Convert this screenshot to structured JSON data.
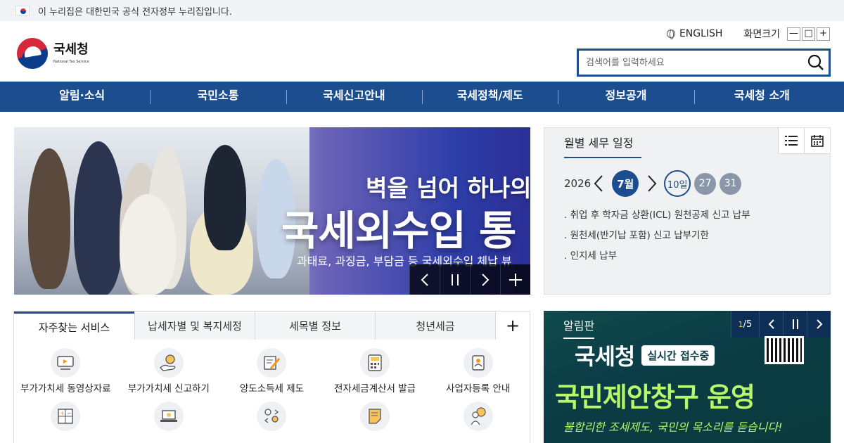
{
  "gov_bar": {
    "text": "이 누리집은 대한민국 공식 전자정부 누리집입니다."
  },
  "logo": {
    "name_ko": "국세청",
    "name_en": "National Tax Service"
  },
  "util": {
    "lang": "ENGLISH",
    "zoom_label": "화면크기",
    "zoom_out": "—",
    "zoom_reset": "□",
    "zoom_in": "+"
  },
  "search": {
    "placeholder": "검색어를 입력하세요"
  },
  "nav": {
    "items": [
      "알림·소식",
      "국민소통",
      "국세신고안내",
      "국세정책/제도",
      "정보공개",
      "국세청 소개"
    ]
  },
  "banner": {
    "headline1": "벽을 넘어 하나의",
    "headline2": "국세외수입 통",
    "sub": "과태료, 과징금, 부담금 등 국세외수입 체납 뷰"
  },
  "schedule": {
    "title": "월별 세무 일정",
    "year": "2026",
    "month": "7월",
    "days": [
      "10일",
      "27",
      "31"
    ],
    "items": [
      "취업 후 학자금 상환(ICL) 원천공제 신고 납부",
      "원천세(반기납 포함) 신고 납부기한",
      "인지세 납부"
    ]
  },
  "services": {
    "tabs": [
      "자주찾는 서비스",
      "납세자별 및 복지세정",
      "세목별 정보",
      "청년세금"
    ],
    "more": "+",
    "items": [
      {
        "label": "부가가치세 동영상자료",
        "icon": "video-icon"
      },
      {
        "label": "부가가치세 신고하기",
        "icon": "hand-coin-icon"
      },
      {
        "label": "양도소득세 제도",
        "icon": "document-pen-icon"
      },
      {
        "label": "전자세금계산서 발급",
        "icon": "calculator-icon"
      },
      {
        "label": "사업자등록 안내",
        "icon": "badge-icon"
      },
      {
        "label": "",
        "icon": "calc-grid-icon"
      },
      {
        "label": "",
        "icon": "laptop-icon"
      },
      {
        "label": "",
        "icon": "people-exchange-icon"
      },
      {
        "label": "",
        "icon": "note-icon"
      },
      {
        "label": "",
        "icon": "idea-person-icon"
      }
    ]
  },
  "notice": {
    "title": "알림판",
    "page_current": "1",
    "page_total": "/5",
    "brand": "국세청",
    "badge": "실시간 접수중",
    "headline": "국민제안창구 운영",
    "sub": "불합리한 조세제도, 국민의 목소리를 듣습니다!"
  },
  "colors": {
    "primary": "#1c4d8f",
    "nav_bg": "#1c4d8f",
    "notice_bg": "#0b3d46",
    "notice_accent": "#b8f76a"
  }
}
